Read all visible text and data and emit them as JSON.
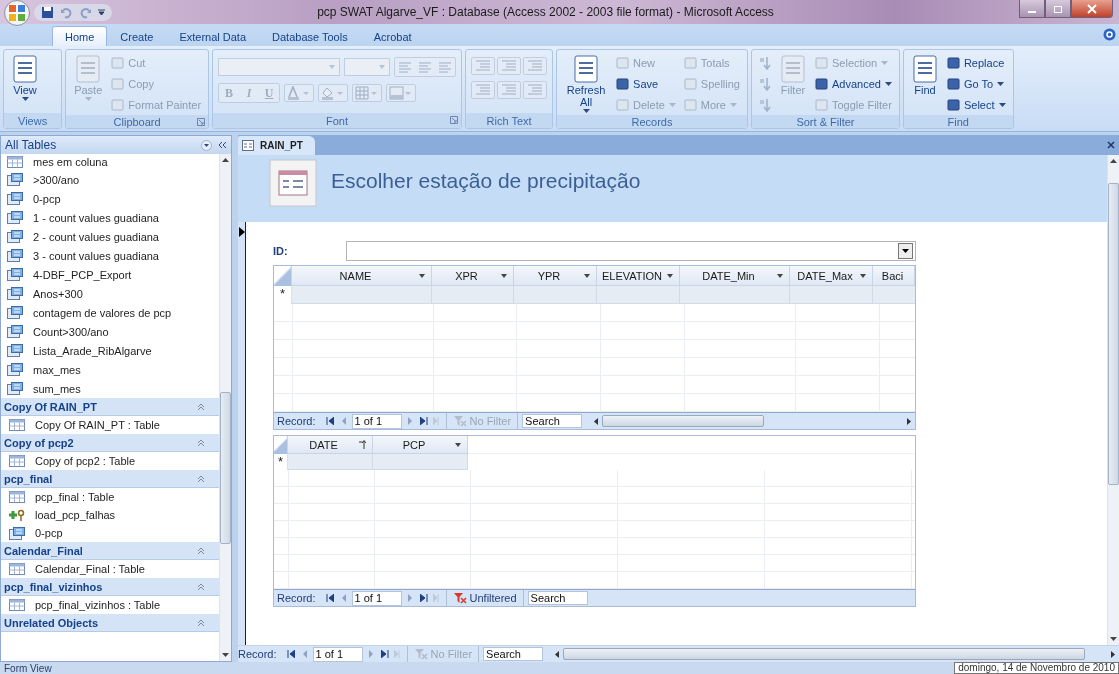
{
  "window": {
    "title": "pcp SWAT Algarve_VF : Database (Access 2002 - 2003 file format) - Microsoft Access"
  },
  "ribbon_tabs": [
    {
      "label": "Home",
      "selected": true
    },
    {
      "label": "Create",
      "selected": false
    },
    {
      "label": "External Data",
      "selected": false
    },
    {
      "label": "Database Tools",
      "selected": false
    },
    {
      "label": "Acrobat",
      "selected": false
    }
  ],
  "ribbon_groups": [
    {
      "label": "Views",
      "kind": "commands",
      "launcher": false,
      "items": [
        {
          "label": "View",
          "kind": "large",
          "disabled": false,
          "caret": true
        }
      ]
    },
    {
      "label": "Clipboard",
      "kind": "commands",
      "launcher": true,
      "items": [
        {
          "label": "Paste",
          "kind": "large",
          "disabled": true,
          "caret": true
        },
        {
          "label": "Cut",
          "kind": "small",
          "disabled": true,
          "caret": false
        },
        {
          "label": "Copy",
          "kind": "small",
          "disabled": true,
          "caret": false
        },
        {
          "label": "Format Painter",
          "kind": "small",
          "disabled": true,
          "caret": false
        }
      ]
    },
    {
      "label": "Font",
      "kind": "font",
      "launcher": true,
      "disabled": true,
      "buttons": [
        "B",
        "I",
        "U"
      ]
    },
    {
      "label": "Rich Text",
      "kind": "icons",
      "launcher": false,
      "disabled": true
    },
    {
      "label": "Records",
      "kind": "commands",
      "launcher": false,
      "items": [
        {
          "label": "Refresh All",
          "kind": "large",
          "disabled": false,
          "caret": true
        },
        {
          "label": "New",
          "kind": "small",
          "disabled": true,
          "caret": false
        },
        {
          "label": "Save",
          "kind": "small",
          "disabled": false,
          "caret": false
        },
        {
          "label": "Delete",
          "kind": "small",
          "disabled": true,
          "caret": true
        },
        {
          "label": "Totals",
          "kind": "small",
          "disabled": true,
          "caret": false
        },
        {
          "label": "Spelling",
          "kind": "small",
          "disabled": true,
          "caret": false
        },
        {
          "label": "More",
          "kind": "small",
          "disabled": true,
          "caret": true
        }
      ]
    },
    {
      "label": "Sort & Filter",
      "kind": "commands",
      "launcher": false,
      "items": [
        {
          "kind": "icon",
          "disabled": true
        },
        {
          "kind": "icon",
          "disabled": true
        },
        {
          "kind": "icon",
          "disabled": true
        },
        {
          "label": "Filter",
          "kind": "large",
          "disabled": true,
          "caret": false
        },
        {
          "label": "Selection",
          "kind": "small",
          "disabled": true,
          "caret": true
        },
        {
          "label": "Advanced",
          "kind": "small",
          "disabled": false,
          "caret": true
        },
        {
          "label": "Toggle Filter",
          "kind": "small",
          "disabled": true,
          "caret": false
        }
      ]
    },
    {
      "label": "Find",
      "kind": "commands",
      "launcher": false,
      "items": [
        {
          "label": "Find",
          "kind": "large",
          "disabled": false,
          "caret": false
        },
        {
          "label": "Replace",
          "kind": "small",
          "disabled": false,
          "caret": false
        },
        {
          "label": "Go To",
          "kind": "small",
          "disabled": false,
          "caret": true
        },
        {
          "label": "Select",
          "kind": "small",
          "disabled": false,
          "caret": true
        }
      ]
    }
  ],
  "nav_pane": {
    "title": "All Tables",
    "sections": [
      {
        "items": [
          {
            "label": "mes em coluna",
            "kind": "table"
          },
          {
            "label": ">300/ano",
            "kind": "query"
          },
          {
            "label": "0-pcp",
            "kind": "query"
          },
          {
            "label": "1 - count values guadiana",
            "kind": "query"
          },
          {
            "label": "2 - count values guadiana",
            "kind": "query"
          },
          {
            "label": "3 - count values guadiana",
            "kind": "query"
          },
          {
            "label": "4-DBF_PCP_Export",
            "kind": "query"
          },
          {
            "label": "Anos+300",
            "kind": "query"
          },
          {
            "label": "contagem de valores de pcp",
            "kind": "query"
          },
          {
            "label": "Count>300/ano",
            "kind": "query"
          },
          {
            "label": "Lista_Arade_RibAlgarve",
            "kind": "query"
          },
          {
            "label": "max_mes",
            "kind": "query"
          },
          {
            "label": "sum_mes",
            "kind": "query"
          }
        ]
      },
      {
        "title": "Copy Of RAIN_PT",
        "items": [
          {
            "label": "Copy Of RAIN_PT : Table",
            "kind": "table"
          }
        ]
      },
      {
        "title": "Copy of pcp2",
        "items": [
          {
            "label": "Copy of pcp2 : Table",
            "kind": "table"
          }
        ]
      },
      {
        "title": "pcp_final",
        "items": [
          {
            "label": "pcp_final : Table",
            "kind": "table"
          },
          {
            "label": "load_pcp_falhas",
            "kind": "macro"
          },
          {
            "label": "0-pcp",
            "kind": "query"
          }
        ]
      },
      {
        "title": "Calendar_Final",
        "items": [
          {
            "label": "Calendar_Final : Table",
            "kind": "table"
          }
        ]
      },
      {
        "title": "pcp_final_vizinhos",
        "items": [
          {
            "label": "pcp_final_vizinhos : Table",
            "kind": "table"
          }
        ]
      },
      {
        "title": "Unrelated Objects"
      }
    ]
  },
  "document_tab": {
    "label": "RAIN_PT",
    "selected": true
  },
  "form": {
    "title": "Escolher estação de precipitação",
    "id_label": "ID:",
    "subforms": [
      {
        "new_row_marker": "*",
        "columns": [
          {
            "label": "NAME",
            "sorted": false
          },
          {
            "label": "XPR",
            "sorted": false
          },
          {
            "label": "YPR",
            "sorted": false
          },
          {
            "label": "ELEVATION",
            "sorted": false
          },
          {
            "label": "DATE_Min",
            "sorted": false
          },
          {
            "label": "DATE_Max",
            "sorted": false
          },
          {
            "label": "Baci",
            "sorted": false
          }
        ],
        "navigator": {
          "record_label": "Record:",
          "position": "1 of 1",
          "filter": "No Filter",
          "filtered": false,
          "search_placeholder": "Search",
          "horizontal_scrollbar": true
        }
      },
      {
        "new_row_marker": "*",
        "columns": [
          {
            "label": "DATE",
            "sorted": true
          },
          {
            "label": "PCP",
            "sorted": false
          }
        ],
        "navigator": {
          "record_label": "Record:",
          "position": "1 of 1",
          "filter": "Unfiltered",
          "filtered": true,
          "search_placeholder": "Search",
          "horizontal_scrollbar": false
        }
      }
    ],
    "navigator": {
      "record_label": "Record:",
      "position": "1 of 1",
      "filter": "No Filter",
      "filtered": false,
      "search_placeholder": "Search",
      "horizontal_scrollbar": true
    }
  },
  "status_bar": {
    "text": "Form View",
    "tooltip": "domingo, 14 de Novembro de 2010"
  }
}
